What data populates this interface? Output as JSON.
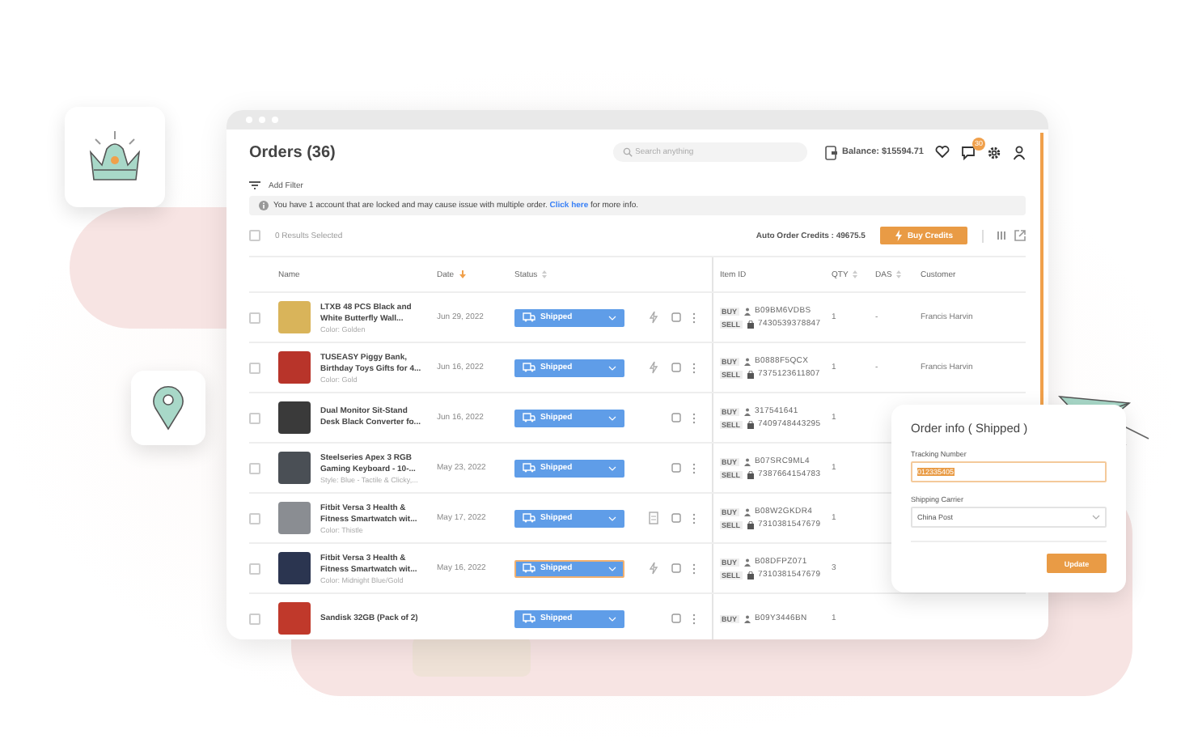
{
  "header": {
    "title": "Orders (36)",
    "search": {
      "placeholder": "Search anything"
    },
    "balance": "Balance: $15594.71",
    "notification_count": "30"
  },
  "filter": {
    "label": "Add Filter"
  },
  "alert": {
    "before": "You have 1 account that are locked and may cause issue with multiple order.",
    "link": "Click here",
    "after": "for more info."
  },
  "toolbar": {
    "all_checked": false,
    "selection": "0 Results Selected",
    "credits": "Auto Order Credits : 49675.5",
    "button": "Buy Credits"
  },
  "table": {
    "columns": [
      {
        "label": "Name",
        "kind": "plain"
      },
      {
        "label": "Date",
        "kind": "sorted"
      },
      {
        "label": "Status",
        "kind": "sortable"
      },
      {
        "label": "Item ID",
        "kind": "plain"
      },
      {
        "label": "QTY",
        "kind": "sortable"
      },
      {
        "label": "DAS",
        "kind": "sortable"
      },
      {
        "label": "Customer",
        "kind": "plain"
      }
    ],
    "rows": [
      {
        "checked": false,
        "name": "LTXB 48 PCS Black and White Butterfly Wall...",
        "variant": "Color: Golden",
        "date": "Jun 29, 2022",
        "status": "Shipped",
        "status_selected": false,
        "bolt_icon": true,
        "receipt_icon": false,
        "buy_tag": "BUY",
        "buy_id": "B09BM6VDBS",
        "sell_tag": "SELL",
        "sell_id": "7430539378847",
        "qty": "1",
        "das": "-",
        "customer": "Francis Harvin"
      },
      {
        "checked": false,
        "name": "TUSEASY Piggy Bank, Birthday Toys Gifts for 4...",
        "variant": "Color: Gold",
        "date": "Jun 16, 2022",
        "status": "Shipped",
        "status_selected": false,
        "bolt_icon": true,
        "receipt_icon": false,
        "buy_tag": "BUY",
        "buy_id": "B0888F5QCX",
        "sell_tag": "SELL",
        "sell_id": "7375123611807",
        "qty": "1",
        "das": "-",
        "customer": "Francis Harvin"
      },
      {
        "checked": false,
        "name": "Dual Monitor Sit-Stand Desk Black Converter fo...",
        "date": "Jun 16, 2022",
        "status": "Shipped",
        "status_selected": false,
        "bolt_icon": false,
        "receipt_icon": false,
        "buy_tag": "BUY",
        "buy_id": "317541641",
        "sell_tag": "SELL",
        "sell_id": "7409748443295",
        "qty": "1"
      },
      {
        "checked": false,
        "name": "Steelseries Apex 3 RGB Gaming Keyboard - 10-...",
        "variant": "Style: Blue - Tactile & Clicky,...",
        "date": "May 23, 2022",
        "status": "Shipped",
        "status_selected": false,
        "bolt_icon": false,
        "receipt_icon": false,
        "buy_tag": "BUY",
        "buy_id": "B07SRC9ML4",
        "sell_tag": "SELL",
        "sell_id": "7387664154783",
        "qty": "1"
      },
      {
        "checked": false,
        "name": "Fitbit Versa 3 Health & Fitness Smartwatch wit...",
        "variant": "Color: Thistle",
        "date": "May 17, 2022",
        "status": "Shipped",
        "status_selected": false,
        "bolt_icon": false,
        "receipt_icon": true,
        "buy_tag": "BUY",
        "buy_id": "B08W2GKDR4",
        "sell_tag": "SELL",
        "sell_id": "7310381547679",
        "qty": "1"
      },
      {
        "checked": false,
        "name": "Fitbit Versa 3 Health & Fitness Smartwatch wit...",
        "variant": "Color: Midnight Blue/Gold",
        "date": "May 16, 2022",
        "status": "Shipped",
        "status_selected": true,
        "bolt_icon": true,
        "receipt_icon": false,
        "buy_tag": "BUY",
        "buy_id": "B08DFPZ071",
        "sell_tag": "SELL",
        "sell_id": "7310381547679",
        "qty": "3"
      },
      {
        "checked": false,
        "name": "Sandisk 32GB (Pack of 2)",
        "status": "Shipped",
        "status_selected": false,
        "bolt_icon": false,
        "receipt_icon": false,
        "buy_tag": "BUY",
        "buy_id": "B09Y3446BN",
        "qty": "1"
      }
    ]
  },
  "popup": {
    "title": "Order info ( Shipped )",
    "tracking_label": "Tracking Number",
    "tracking_value": "012335405",
    "tracking_highlighted": true,
    "carrier_label": "Shipping Carrier",
    "carrier_value": "China Post",
    "button": "Update"
  }
}
